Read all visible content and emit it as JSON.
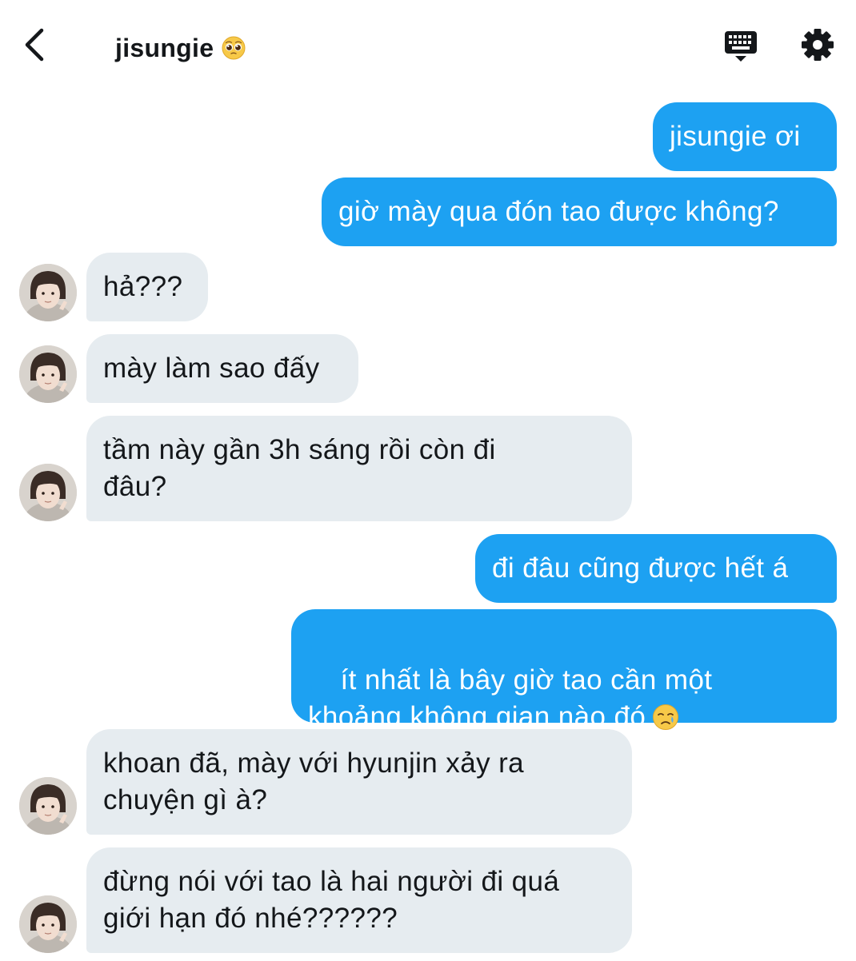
{
  "header": {
    "title": "jisungie",
    "title_emoji": "pleading-face",
    "back_icon": "chevron-left-icon",
    "keyboard_icon": "keyboard-icon",
    "settings_icon": "gear-icon"
  },
  "colors": {
    "outgoing_bubble": "#1da1f2",
    "incoming_bubble": "#e6ecf0",
    "incoming_text": "#14171a",
    "outgoing_text": "#ffffff"
  },
  "messages": [
    {
      "direction": "out",
      "text": "jisungie ơi"
    },
    {
      "direction": "out",
      "text": "giờ mày qua đón tao được không?"
    },
    {
      "direction": "in",
      "text": "hả???"
    },
    {
      "direction": "in",
      "text": "mày làm sao đấy"
    },
    {
      "direction": "in",
      "text": "tầm này gần 3h sáng rồi còn đi\nđâu?"
    },
    {
      "direction": "out",
      "text": "đi đâu cũng được hết á"
    },
    {
      "direction": "out",
      "text": "ít nhất là bây giờ tao cần một\nkhoảng không gian nào đó",
      "emoji": "crying-face"
    },
    {
      "direction": "in",
      "text": "khoan đã, mày với hyunjin xảy ra\nchuyện gì à?"
    },
    {
      "direction": "in",
      "text": "đừng nói với tao là hai người đi quá\ngiới hạn đó nhé??????"
    }
  ]
}
